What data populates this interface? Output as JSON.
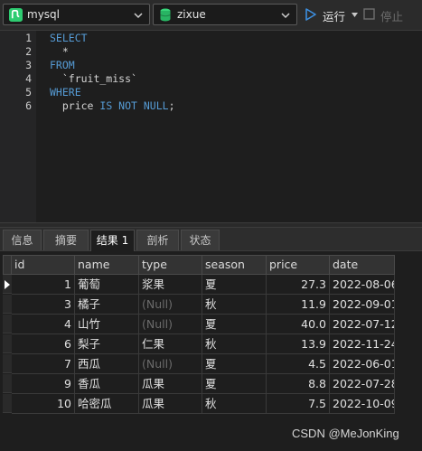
{
  "toolbar": {
    "connection": "mysql",
    "database": "zixue",
    "run_label": "运行",
    "stop_label": "停止"
  },
  "editor": {
    "line_numbers": [
      "1",
      "2",
      "3",
      "4",
      "5",
      "6"
    ],
    "lines": [
      [
        {
          "t": "SELECT",
          "kw": true
        }
      ],
      [
        {
          "t": "  *",
          "kw": false
        }
      ],
      [
        {
          "t": "FROM",
          "kw": true
        }
      ],
      [
        {
          "t": "  `fruit_miss`",
          "kw": false
        }
      ],
      [
        {
          "t": "WHERE",
          "kw": true
        }
      ],
      [
        {
          "t": "  price ",
          "kw": false
        },
        {
          "t": "IS NOT NULL",
          "kw": true
        },
        {
          "t": ";",
          "kw": false
        }
      ]
    ]
  },
  "tabs": [
    {
      "label": "信息",
      "active": false
    },
    {
      "label": "摘要",
      "active": false
    },
    {
      "label": "结果 1",
      "active": true
    },
    {
      "label": "剖析",
      "active": false
    },
    {
      "label": "状态",
      "active": false
    }
  ],
  "grid": {
    "columns": [
      "id",
      "name",
      "type",
      "season",
      "price",
      "date"
    ],
    "rows": [
      [
        "1",
        "葡萄",
        "浆果",
        "夏",
        "27.3",
        "2022-08-06"
      ],
      [
        "3",
        "橘子",
        "(Null)",
        "秋",
        "11.9",
        "2022-09-01"
      ],
      [
        "4",
        "山竹",
        "(Null)",
        "夏",
        "40.0",
        "2022-07-12"
      ],
      [
        "6",
        "梨子",
        "仁果",
        "秋",
        "13.9",
        "2022-11-24"
      ],
      [
        "7",
        "西瓜",
        "(Null)",
        "夏",
        "4.5",
        "2022-06-01"
      ],
      [
        "9",
        "香瓜",
        "瓜果",
        "夏",
        "8.8",
        "2022-07-28"
      ],
      [
        "10",
        "哈密瓜",
        "瓜果",
        "秋",
        "7.5",
        "2022-10-09"
      ]
    ],
    "selected_row": 0
  },
  "watermark": "CSDN @MeJonKing",
  "colors": {
    "keyword": "#569cd6",
    "null_text": "#6b6b6b",
    "run_icon": "#3d8fe0",
    "db_icon": "#28b463",
    "conn_icon": "#2ecc71"
  },
  "icons": {
    "connection": "connection-icon",
    "database": "database-icon",
    "run": "play-icon",
    "stop": "stop-icon"
  }
}
